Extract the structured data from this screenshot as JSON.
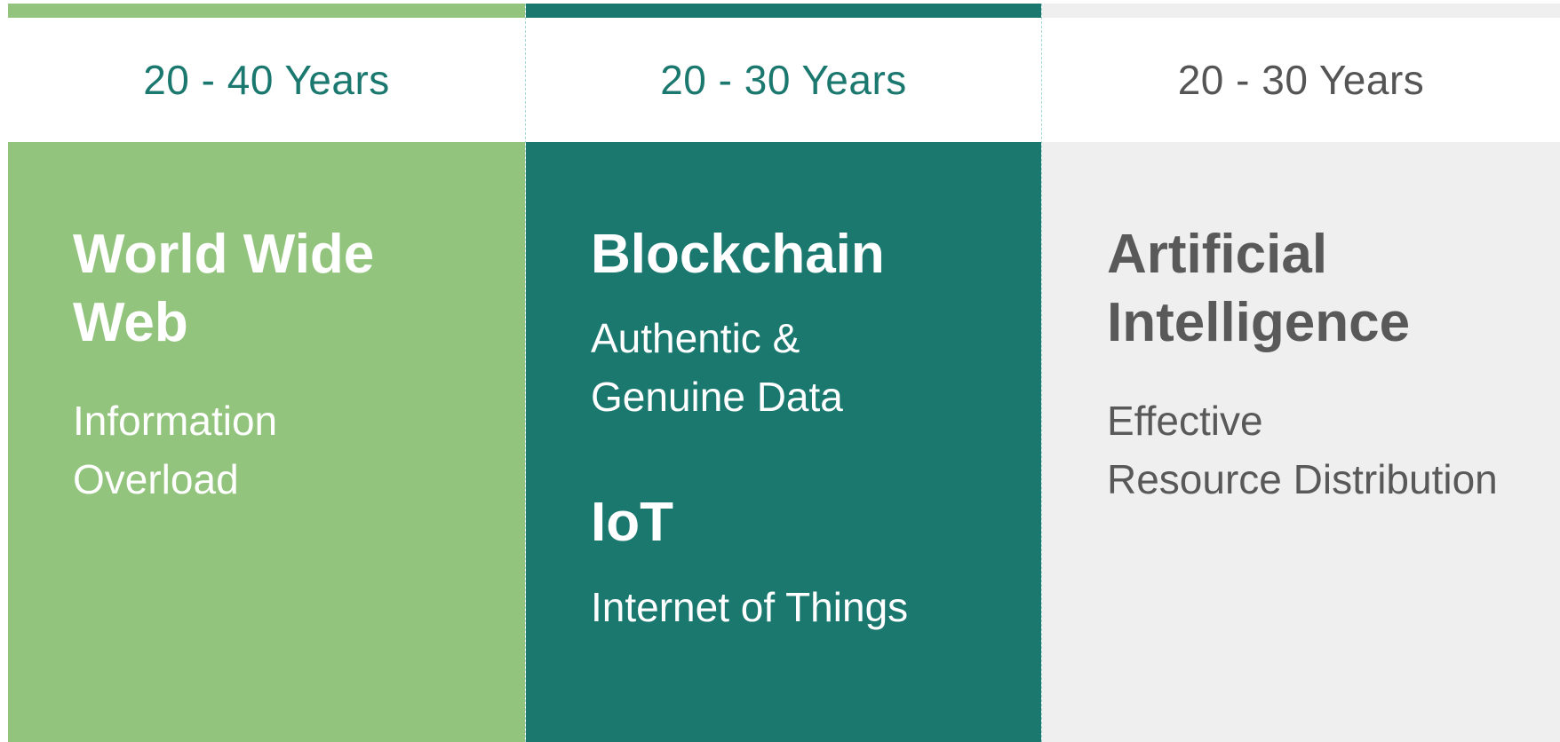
{
  "columns": [
    {
      "duration": "20 - 40 Years",
      "title_lines": [
        "World Wide",
        "Web"
      ],
      "description_lines": [
        "Information",
        "Overload"
      ],
      "accent_color": "#93c47d"
    },
    {
      "duration": "20 - 30 Years",
      "sections": [
        {
          "title_lines": [
            "Blockchain"
          ],
          "description_lines": [
            "Authentic &",
            "Genuine Data"
          ]
        },
        {
          "title_lines": [
            "IoT"
          ],
          "description_lines": [
            "Internet of Things"
          ]
        }
      ],
      "accent_color": "#1b786f"
    },
    {
      "duration": "20 - 30 Years",
      "title_lines": [
        "Artificial",
        "Intelligence"
      ],
      "description_lines": [
        "Effective",
        "Resource Distribution"
      ],
      "accent_color": "#efefef"
    }
  ]
}
